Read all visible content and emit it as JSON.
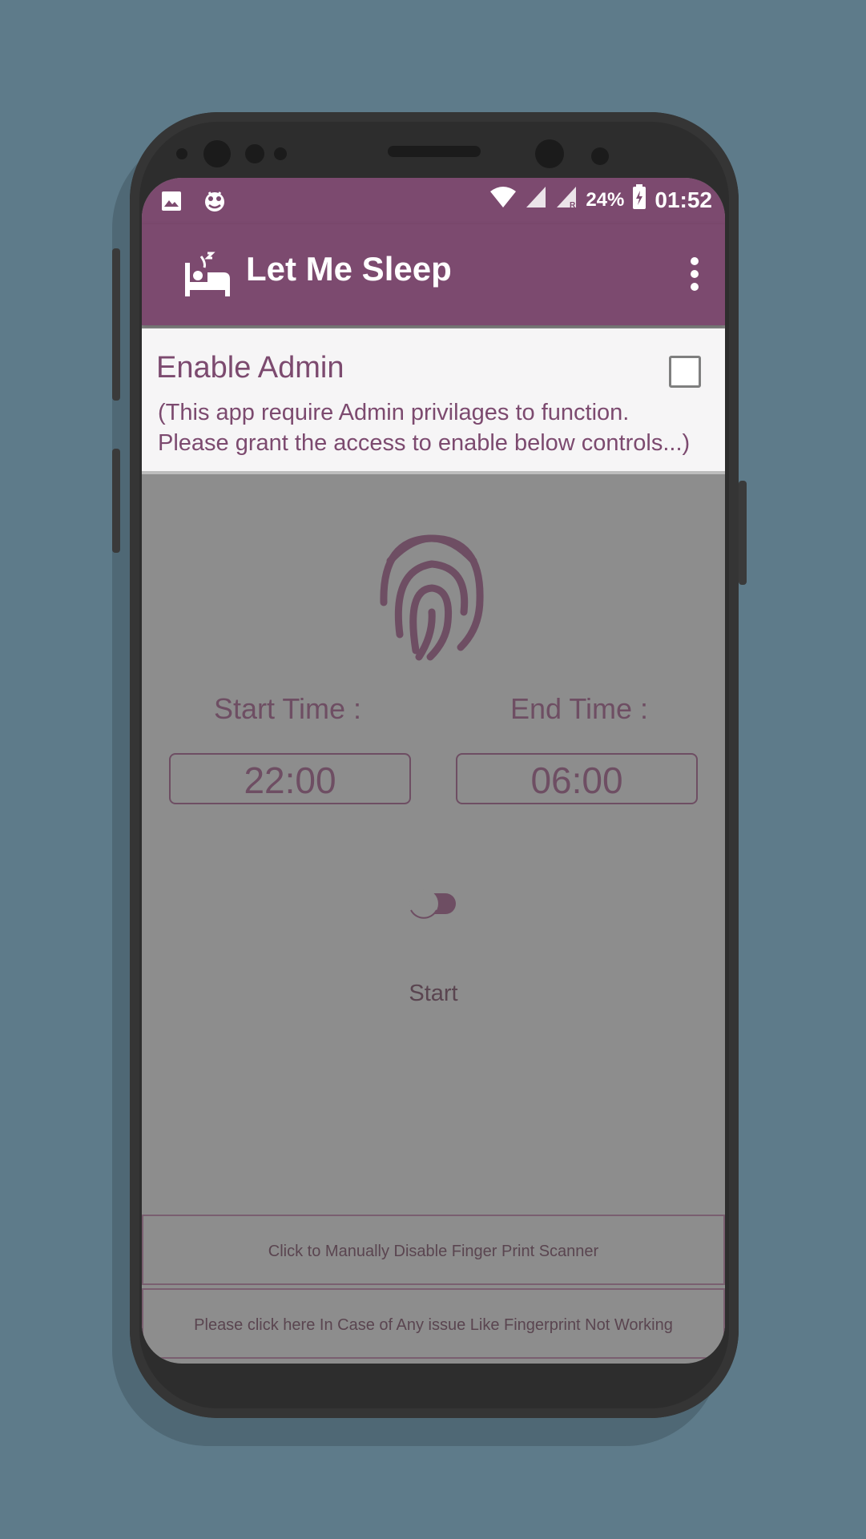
{
  "status_bar": {
    "battery_percent": "24%",
    "time": "01:52",
    "icons": [
      "image-icon",
      "debug-icon",
      "wifi-icon",
      "signal-icon",
      "signal-r-icon",
      "battery-charging-icon"
    ]
  },
  "app_bar": {
    "title": "Let Me Sleep",
    "icon": "sleep-bed-icon",
    "menu_icon": "overflow-menu-icon"
  },
  "admin": {
    "title": "Enable Admin",
    "description": "(This app require Admin privilages to function. Please grant the access to enable below controls...)",
    "checked": false
  },
  "schedule": {
    "start_label": "Start Time :",
    "start_value": "22:00",
    "end_label": "End Time :",
    "end_value": "06:00"
  },
  "control": {
    "toggle_on": false,
    "label": "Start"
  },
  "buttons": {
    "disable_scanner": "Click to Manually Disable Finger Print Scanner",
    "report_issue": "Please click here In Case of Any issue Like Fingerprint Not Working"
  },
  "colors": {
    "primary": "#7c4a6f",
    "disabled_bg": "#8d8d8d",
    "background": "#5e7b8a"
  }
}
